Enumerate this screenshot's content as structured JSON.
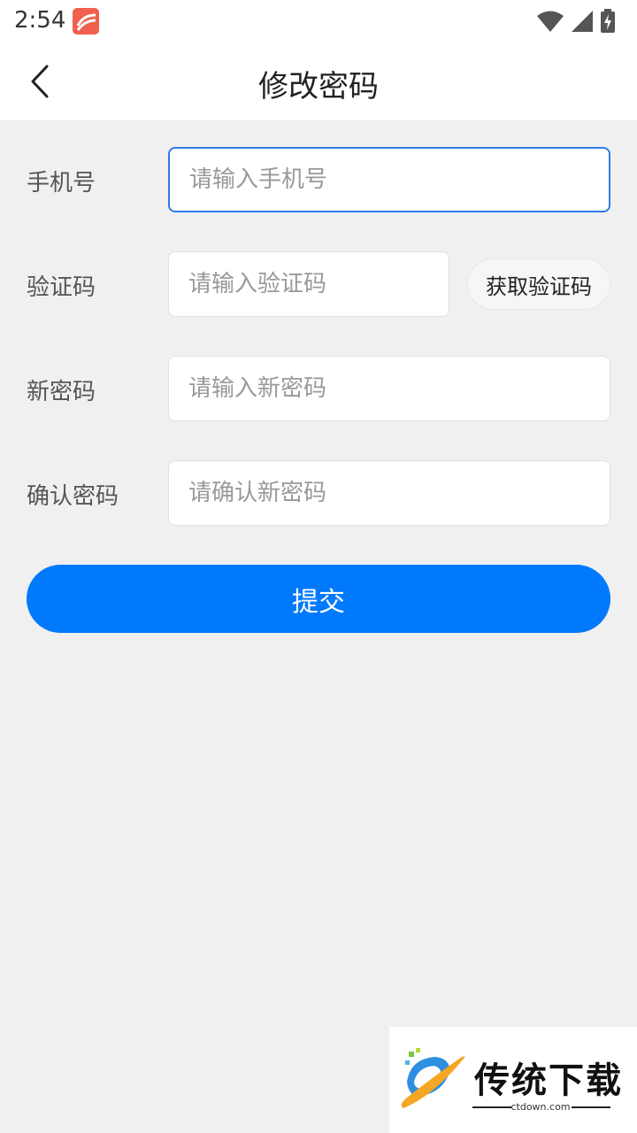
{
  "status_bar": {
    "time": "2:54",
    "icons": [
      "app-notification-icon",
      "wifi-icon",
      "signal-icon",
      "battery-charging-icon"
    ]
  },
  "header": {
    "title": "修改密码",
    "back_icon": "chevron-left-icon"
  },
  "form": {
    "phone": {
      "label": "手机号",
      "placeholder": "请输入手机号",
      "value": ""
    },
    "code": {
      "label": "验证码",
      "placeholder": "请输入验证码",
      "value": "",
      "button_label": "获取验证码"
    },
    "new_password": {
      "label": "新密码",
      "placeholder": "请输入新密码",
      "value": ""
    },
    "confirm_password": {
      "label": "确认密码",
      "placeholder": "请确认新密码",
      "value": ""
    },
    "submit_label": "提交"
  },
  "watermark": {
    "brand": "传统下载",
    "domain": "ctdown.com"
  },
  "colors": {
    "accent": "#0079fc",
    "focus_border": "#2f7bea",
    "background": "#f0f0f0",
    "status_app_icon": "#f0604d"
  }
}
